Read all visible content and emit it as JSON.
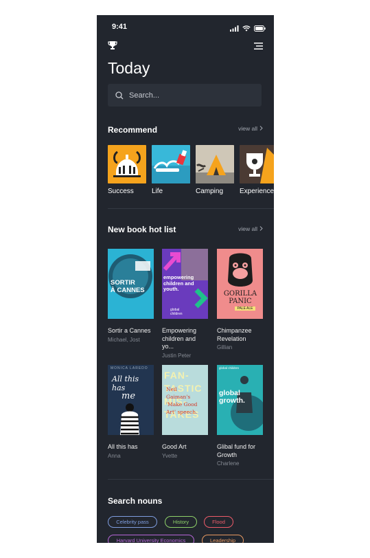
{
  "status": {
    "time": "9:41"
  },
  "header": {
    "title": "Today",
    "search_placeholder": "Search..."
  },
  "recommend": {
    "title": "Recommend",
    "view_all": "view all",
    "items": [
      {
        "label": "Success"
      },
      {
        "label": "Life"
      },
      {
        "label": "Camping"
      },
      {
        "label": "Experience"
      }
    ]
  },
  "hotlist": {
    "title": "New book hot list",
    "view_all": "view all",
    "books": [
      {
        "title": "Sortir a Cannes",
        "author": "Michael, Jost",
        "cover_text": "SORTIR\nÀ CANNES",
        "cover_color": "#2bb3d4"
      },
      {
        "title": "Empowering children and yo...",
        "author": "Justin Peter",
        "cover_text": "empowering children and youth.",
        "cover_sub": "global children",
        "cover_color": "#6a3bbd"
      },
      {
        "title": "Chimpanzee Revelation",
        "author": "Gillian",
        "cover_text": "GORILLA PANIC",
        "cover_sub": "PALE ALE",
        "cover_color": "#f08c8c"
      },
      {
        "title": "All this has",
        "author": "Anna",
        "cover_text": "All this has",
        "cover_sub": "me",
        "cover_top": "MONICA LAREDO",
        "cover_color": "#223550"
      },
      {
        "title": "Good Art",
        "author": "Yvette",
        "cover_text": "FAN- TASTIC MIS- TAKES",
        "cover_quote": "Neil Gaiman's 'Make Good Art' speech.",
        "cover_color": "#b9dcdc"
      },
      {
        "title": "Glibal fund for Growth",
        "author": "Charlene",
        "cover_text": "global growth.",
        "cover_sub": "global children",
        "cover_color": "#29b0b3"
      }
    ]
  },
  "search_nouns": {
    "title": "Search nouns",
    "chips": [
      {
        "label": "Celebrity pass",
        "color": "#7f9ee0"
      },
      {
        "label": "History",
        "color": "#8fd26a"
      },
      {
        "label": "Flood",
        "color": "#ef5c6a"
      },
      {
        "label": "Harvard University Economics",
        "color": "#b767d9"
      },
      {
        "label": "Leadership",
        "color": "#e89a62"
      }
    ]
  }
}
